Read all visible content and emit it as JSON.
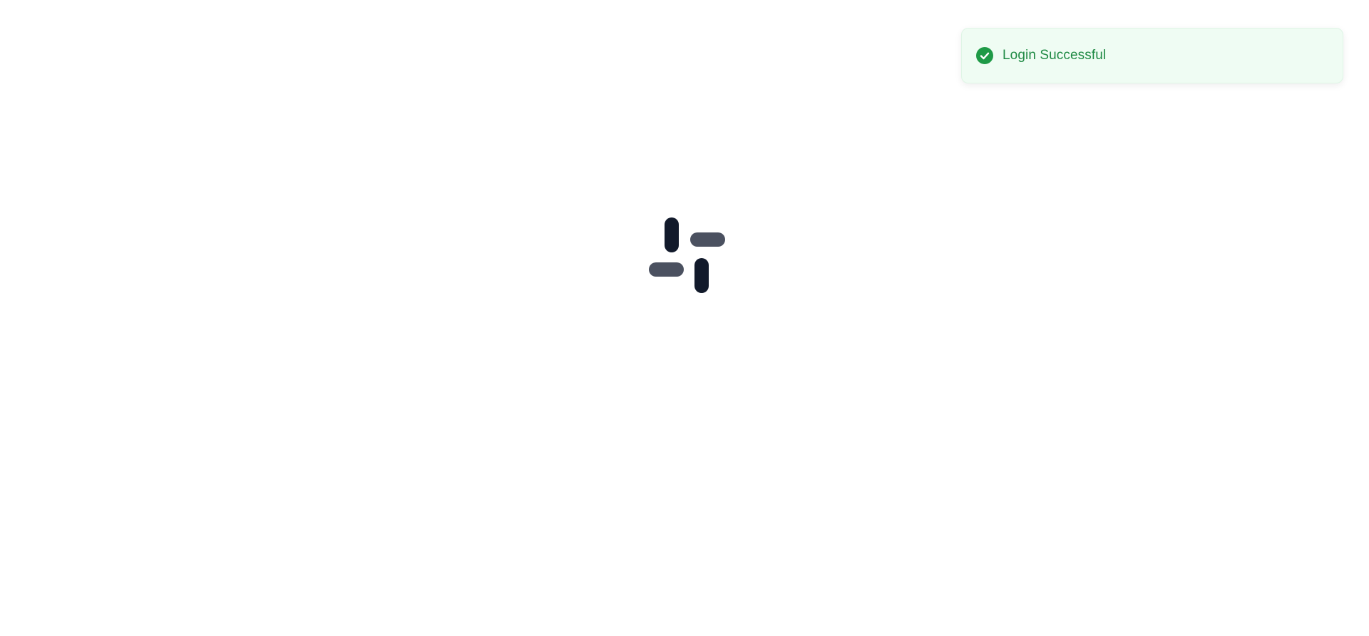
{
  "toast": {
    "message": "Login Successful",
    "icon": "check-circle-icon",
    "colors": {
      "background": "#effcf3",
      "icon": "#1f9a47",
      "text": "#1f8a44"
    }
  },
  "loader": {
    "icon": "loading-spinner-icon",
    "colors": {
      "dark": "#121a2b",
      "muted": "#4b5160"
    }
  }
}
